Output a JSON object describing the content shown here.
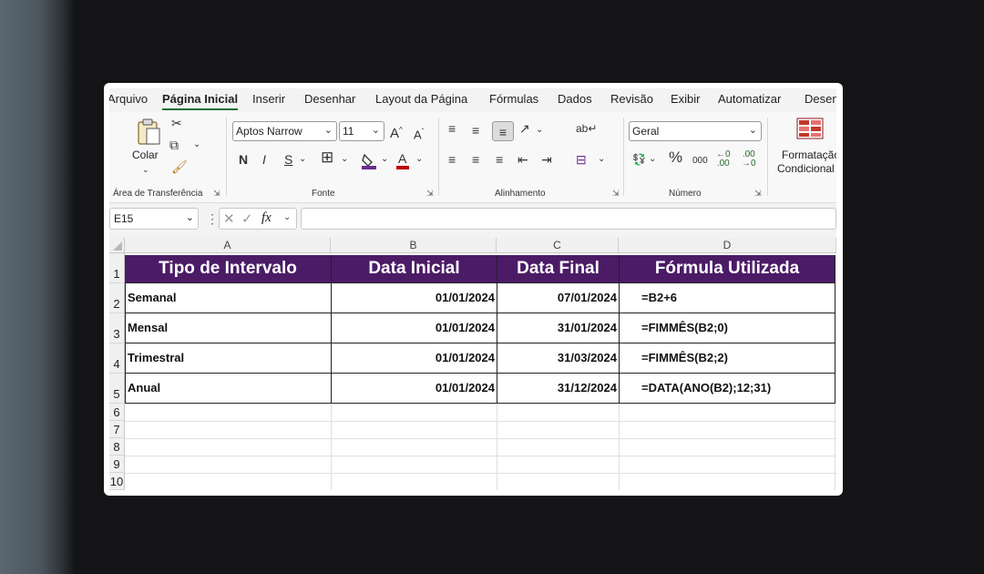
{
  "menu": {
    "tabs": [
      "Arquivo",
      "Página Inicial",
      "Inserir",
      "Desenhar",
      "Layout da Página",
      "Fórmulas",
      "Dados",
      "Revisão",
      "Exibir",
      "Automatizar",
      "Desen"
    ],
    "active": "Página Inicial"
  },
  "ribbon": {
    "clipboard": {
      "paste_label": "Colar",
      "group_label": "Área de Transferência"
    },
    "font": {
      "family": "Aptos Narrow",
      "size": "11",
      "bold": "N",
      "italic": "I",
      "underline": "S",
      "group_label": "Fonte"
    },
    "alignment": {
      "group_label": "Alinhamento"
    },
    "number": {
      "format": "Geral",
      "group_label": "Número"
    },
    "styles": {
      "conditional_label_1": "Formatação",
      "conditional_label_2": "Condicional"
    }
  },
  "formula_bar": {
    "name_box": "E15",
    "fx": "fx",
    "value": ""
  },
  "sheet": {
    "columns": [
      "A",
      "B",
      "C",
      "D"
    ],
    "rows": [
      "1",
      "2",
      "3",
      "4",
      "5",
      "6",
      "7",
      "8",
      "9",
      "10"
    ],
    "header": [
      "Tipo de Intervalo",
      "Data Inicial",
      "Data Final",
      "Fórmula Utilizada"
    ],
    "data": [
      [
        "Semanal",
        "01/01/2024",
        "07/01/2024",
        "=B2+6"
      ],
      [
        "Mensal",
        "01/01/2024",
        "31/01/2024",
        "=FIMMÊS(B2;0)"
      ],
      [
        "Trimestral",
        "01/01/2024",
        "31/03/2024",
        "=FIMMÊS(B2;2)"
      ],
      [
        "Anual",
        "01/01/2024",
        "31/12/2024",
        "=DATA(ANO(B2);12;31)"
      ]
    ],
    "header_color": "#4b1b66"
  },
  "colors": {
    "active_tab_underline": "#1b6f3a",
    "border": "#222222"
  }
}
